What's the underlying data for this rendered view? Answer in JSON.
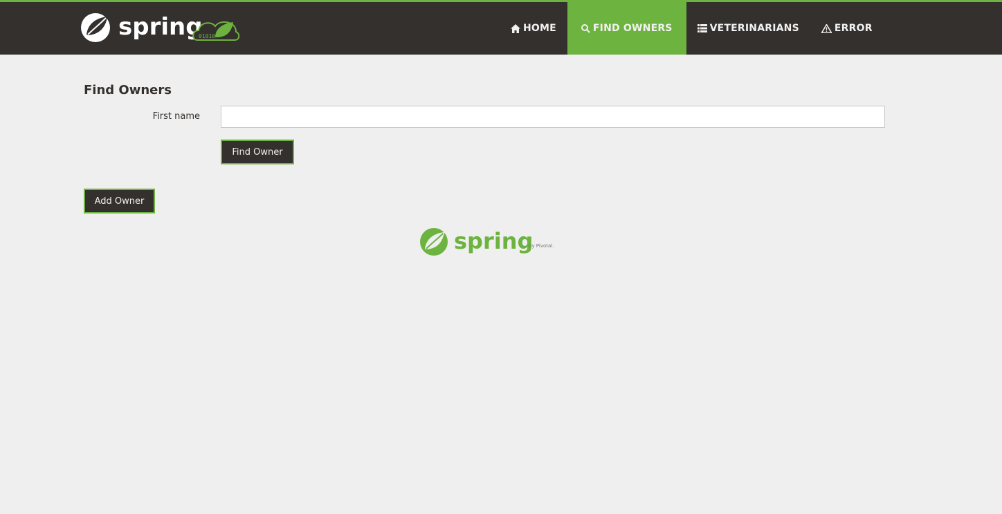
{
  "header": {
    "brand_text": "spring",
    "brand_badge_text": "01010",
    "nav": [
      {
        "label": "HOME",
        "icon": "home-icon",
        "active": false
      },
      {
        "label": "FIND OWNERS",
        "icon": "search-icon",
        "active": true
      },
      {
        "label": "VETERINARIANS",
        "icon": "list-icon",
        "active": false
      },
      {
        "label": "ERROR",
        "icon": "warning-icon",
        "active": false
      }
    ]
  },
  "main": {
    "title": "Find Owners",
    "form": {
      "first_name_label": "First name",
      "first_name_value": "",
      "first_name_placeholder": "",
      "find_button_label": "Find Owner"
    },
    "add_button_label": "Add Owner"
  },
  "footer": {
    "logo_text": "spring",
    "byline": "by Pivotal."
  },
  "colors": {
    "accent": "#6db33f",
    "nav_background": "#34302d",
    "page_background": "#efefef"
  }
}
